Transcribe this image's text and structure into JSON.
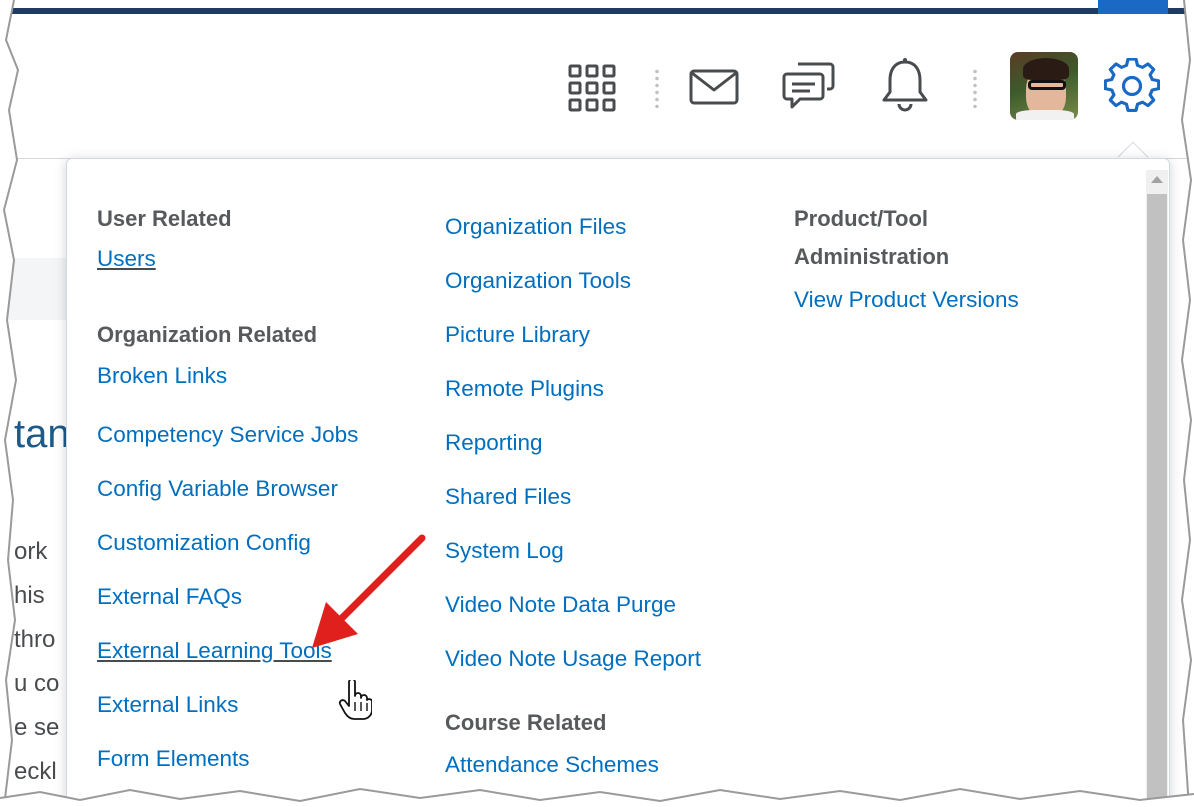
{
  "header": {
    "icons": {
      "apps": "grid-icon",
      "mail": "envelope-icon",
      "chat": "chat-bubbles-icon",
      "notifications": "bell-icon",
      "settings": "gear-icon"
    },
    "avatar_alt": "user-avatar"
  },
  "background_page": {
    "title_fragment": "tan",
    "lines": [
      "ork",
      "his",
      "thro",
      "u co",
      "e se",
      "eckl"
    ]
  },
  "admin_menu": {
    "col1": {
      "sections": [
        {
          "heading": "User Related",
          "links": [
            "Users"
          ]
        },
        {
          "heading": "Organization Related",
          "links": [
            "Broken Links",
            "Competency Service Jobs",
            "Config Variable Browser",
            "Customization Config",
            "External FAQs",
            "External Learning Tools",
            "External Links",
            "Form Elements"
          ]
        }
      ]
    },
    "col2": {
      "links": [
        "Organization Files",
        "Organization Tools",
        "Picture Library",
        "Remote Plugins",
        "Reporting",
        "Shared Files",
        "System Log",
        "Video Note Data Purge",
        "Video Note Usage Report"
      ],
      "course_heading": "Course Related",
      "course_links": [
        "Attendance Schemes"
      ]
    },
    "col3": {
      "heading_line1": "Product/Tool",
      "heading_line2": "Administration",
      "links": [
        "View Product Versions"
      ]
    }
  },
  "colors": {
    "link": "#006fbf",
    "heading": "#565a5c",
    "arrow": "#e0201c",
    "top_stripe": "#1f3b63",
    "gear": "#1a6ac5"
  }
}
